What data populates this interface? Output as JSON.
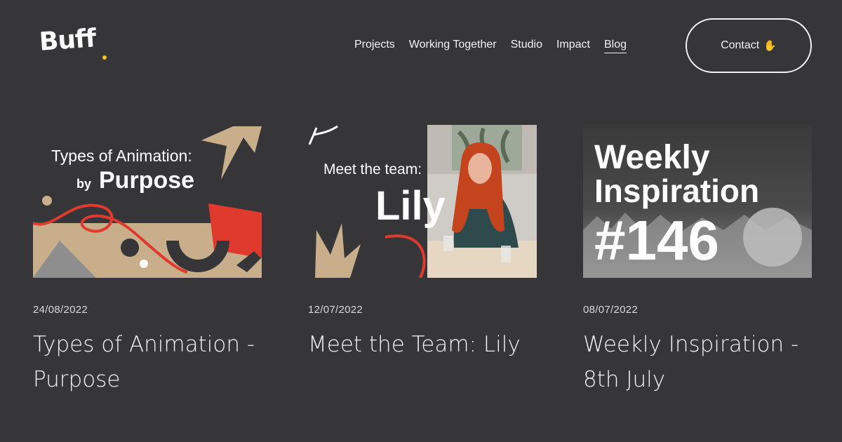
{
  "brand": {
    "logo_text": "Buff",
    "logo_dot_color": "#f5c518"
  },
  "nav": {
    "items": [
      "Projects",
      "Working Together",
      "Studio",
      "Impact",
      "Blog"
    ],
    "active": "Blog"
  },
  "contact": {
    "label": "Contact",
    "icon": "waving-hand-icon"
  },
  "posts": [
    {
      "thumb": {
        "line1": "Types of Animation:",
        "line2_small": "by",
        "line2_big": "Purpose"
      },
      "date": "24/08/2022",
      "title": "Types of Animation - Purpose"
    },
    {
      "thumb": {
        "line1": "Meet the team:",
        "line2": "Lily"
      },
      "date": "12/07/2022",
      "title": "Meet the Team: Lily"
    },
    {
      "thumb": {
        "line1": "Weekly",
        "line2": "Inspiration",
        "line3": "#146"
      },
      "date": "08/07/2022",
      "title": "Weekly Inspiration - 8th July"
    }
  ],
  "colors": {
    "background": "#363537",
    "accent_red": "#e03a2f",
    "accent_tan": "#c8ae8a"
  }
}
